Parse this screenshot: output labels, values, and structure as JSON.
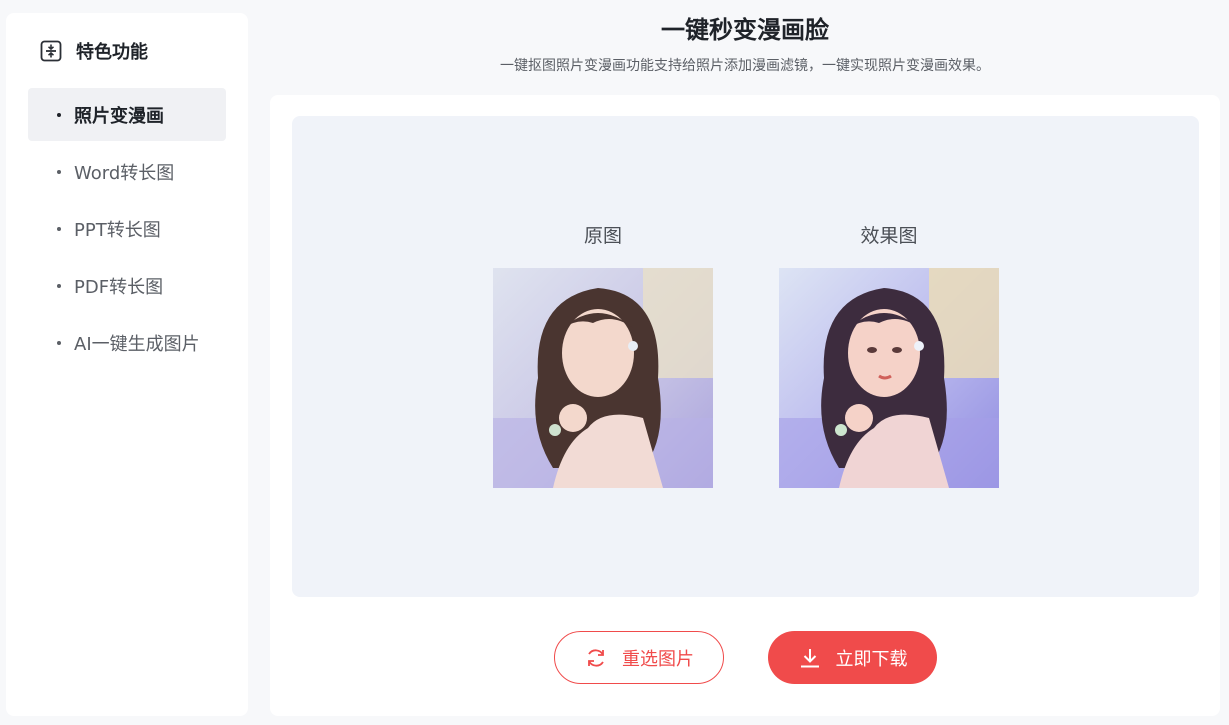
{
  "sidebar": {
    "title": "特色功能",
    "items": [
      {
        "label": "照片变漫画",
        "active": true
      },
      {
        "label": "Word转长图",
        "active": false
      },
      {
        "label": "PPT转长图",
        "active": false
      },
      {
        "label": "PDF转长图",
        "active": false
      },
      {
        "label": "AI一键生成图片",
        "active": false
      }
    ]
  },
  "main": {
    "title": "一键秒变漫画脸",
    "subtitle": "一键抠图照片变漫画功能支持给照片添加漫画滤镜，一键实现照片变漫画效果。",
    "original_label": "原图",
    "result_label": "效果图",
    "reselect_label": "重选图片",
    "download_label": "立即下载"
  },
  "colors": {
    "accent": "#f04b4b",
    "active_bg": "#f0f1f4",
    "preview_bg": "#f0f3f9"
  }
}
